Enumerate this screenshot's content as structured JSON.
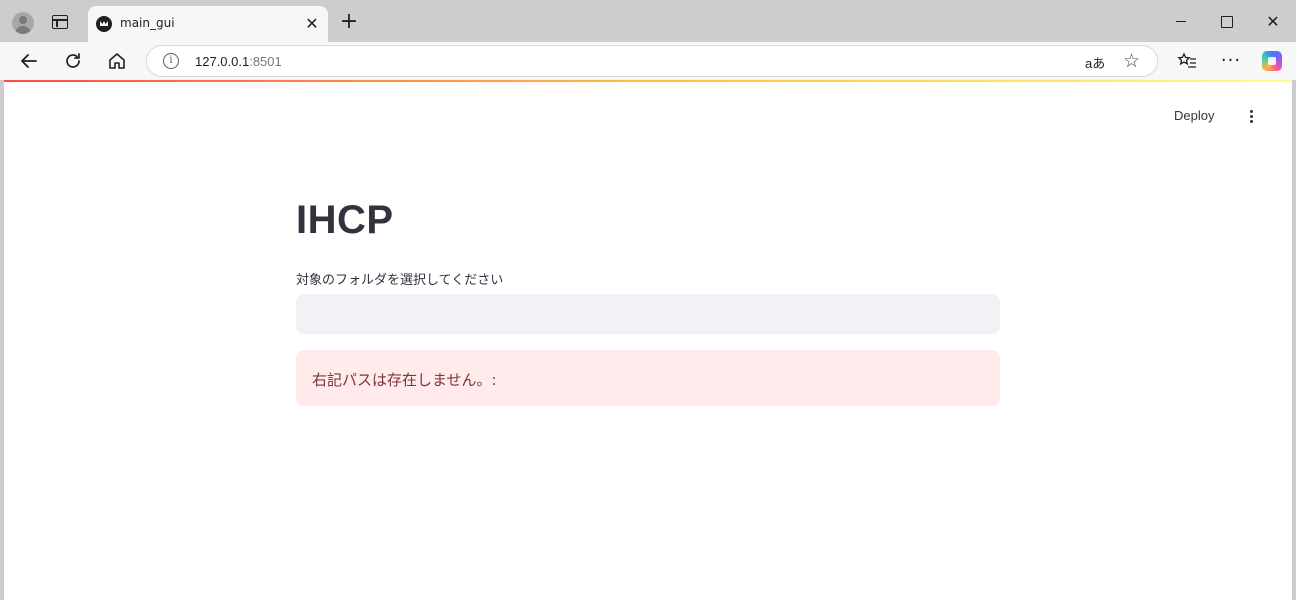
{
  "browser": {
    "tab_title": "main_gui",
    "tab_close": "✕",
    "new_tab": "+",
    "url_host": "127.0.0.1",
    "url_port": ":8501",
    "read_aloud": "aあ",
    "window_close": "✕"
  },
  "app": {
    "deploy_label": "Deploy",
    "title": "IHCP",
    "folder_label": "対象のフォルダを選択してください",
    "folder_value": "",
    "error_message": "右記パスは存在しません。:"
  },
  "colors": {
    "accent_gradient_start": "#ff4b4b",
    "input_bg": "#f0f2f6",
    "error_bg": "#ffebeb",
    "error_text": "#7d353b",
    "text": "#31333f"
  }
}
